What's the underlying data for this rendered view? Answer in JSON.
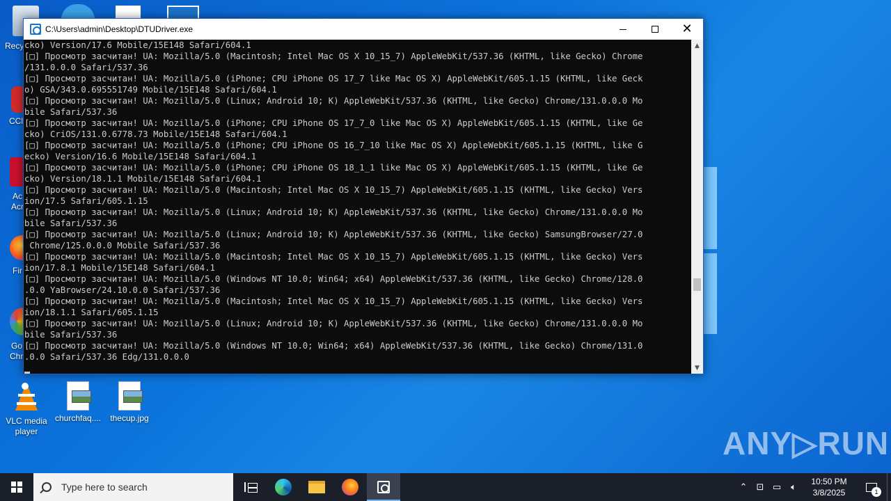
{
  "window": {
    "title": "C:\\Users\\admin\\Desktop\\DTUDriver.exe"
  },
  "console": {
    "lines": [
      "cko) Version/17.6 Mobile/15E148 Safari/604.1",
      "[□] Просмотр засчитан! UA: Mozilla/5.0 (Macintosh; Intel Mac OS X 10_15_7) AppleWebKit/537.36 (KHTML, like Gecko) Chrome",
      "/131.0.0.0 Safari/537.36",
      "[□] Просмотр засчитан! UA: Mozilla/5.0 (iPhone; CPU iPhone OS 17_7 like Mac OS X) AppleWebKit/605.1.15 (KHTML, like Geck",
      "o) GSA/343.0.695551749 Mobile/15E148 Safari/604.1",
      "[□] Просмотр засчитан! UA: Mozilla/5.0 (Linux; Android 10; K) AppleWebKit/537.36 (KHTML, like Gecko) Chrome/131.0.0.0 Mo",
      "bile Safari/537.36",
      "[□] Просмотр засчитан! UA: Mozilla/5.0 (iPhone; CPU iPhone OS 17_7_0 like Mac OS X) AppleWebKit/605.1.15 (KHTML, like Ge",
      "cko) CriOS/131.0.6778.73 Mobile/15E148 Safari/604.1",
      "[□] Просмотр засчитан! UA: Mozilla/5.0 (iPhone; CPU iPhone OS 16_7_10 like Mac OS X) AppleWebKit/605.1.15 (KHTML, like G",
      "ecko) Version/16.6 Mobile/15E148 Safari/604.1",
      "[□] Просмотр засчитан! UA: Mozilla/5.0 (iPhone; CPU iPhone OS 18_1_1 like Mac OS X) AppleWebKit/605.1.15 (KHTML, like Ge",
      "cko) Version/18.1.1 Mobile/15E148 Safari/604.1",
      "[□] Просмотр засчитан! UA: Mozilla/5.0 (Macintosh; Intel Mac OS X 10_15_7) AppleWebKit/605.1.15 (KHTML, like Gecko) Vers",
      "ion/17.5 Safari/605.1.15",
      "[□] Просмотр засчитан! UA: Mozilla/5.0 (Linux; Android 10; K) AppleWebKit/537.36 (KHTML, like Gecko) Chrome/131.0.0.0 Mo",
      "bile Safari/537.36",
      "[□] Просмотр засчитан! UA: Mozilla/5.0 (Linux; Android 10; K) AppleWebKit/537.36 (KHTML, like Gecko) SamsungBrowser/27.0",
      " Chrome/125.0.0.0 Mobile Safari/537.36",
      "[□] Просмотр засчитан! UA: Mozilla/5.0 (Macintosh; Intel Mac OS X 10_15_7) AppleWebKit/605.1.15 (KHTML, like Gecko) Vers",
      "ion/17.8.1 Mobile/15E148 Safari/604.1",
      "[□] Просмотр засчитан! UA: Mozilla/5.0 (Windows NT 10.0; Win64; x64) AppleWebKit/537.36 (KHTML, like Gecko) Chrome/128.0",
      ".0.0 YaBrowser/24.10.0.0 Safari/537.36",
      "[□] Просмотр засчитан! UA: Mozilla/5.0 (Macintosh; Intel Mac OS X 10_15_7) AppleWebKit/605.1.15 (KHTML, like Gecko) Vers",
      "ion/18.1.1 Safari/605.1.15",
      "[□] Просмотр засчитан! UA: Mozilla/5.0 (Linux; Android 10; K) AppleWebKit/537.36 (KHTML, like Gecko) Chrome/131.0.0.0 Mo",
      "bile Safari/537.36",
      "[□] Просмотр засчитан! UA: Mozilla/5.0 (Windows NT 10.0; Win64; x64) AppleWebKit/537.36 (KHTML, like Gecko) Chrome/131.0",
      ".0.0 Safari/537.36 Edg/131.0.0.0"
    ]
  },
  "desktop": {
    "icons": [
      {
        "label": "VLC media player",
        "icon": "vlc-icon"
      },
      {
        "label": "churchfaq....",
        "icon": "image-file-icon"
      },
      {
        "label": "thecup.jpg",
        "icon": "image-file-icon"
      }
    ],
    "partial_labels": [
      "Recycl",
      "CCl",
      "Ac",
      "Acr",
      "Fir",
      "Go",
      "Chr"
    ]
  },
  "watermark": "ANY▷RUN",
  "taskbar": {
    "search_placeholder": "Type here to search",
    "clock_time": "10:50 PM",
    "clock_date": "3/8/2025",
    "notification_count": "1"
  },
  "colors": {
    "console_bg": "#0c0c0c",
    "console_fg": "#cccccc",
    "taskbar_bg": "#1b1f2a",
    "accent": "#0078d7"
  }
}
